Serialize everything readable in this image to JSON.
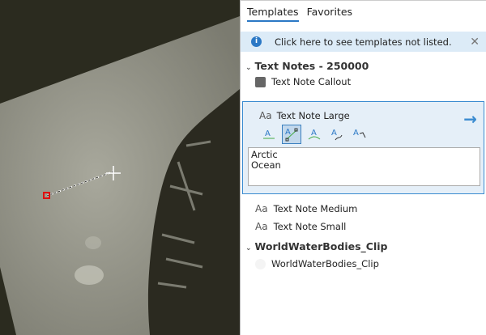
{
  "tabs": [
    {
      "label": "Templates",
      "active": true
    },
    {
      "label": "Favorites",
      "active": false
    }
  ],
  "info": {
    "text": "Click here to see templates not listed.",
    "icon": "info-icon"
  },
  "groups": [
    {
      "label": "Text Notes - 250000",
      "items": [
        {
          "label": "Text Note Callout",
          "icon": "callout-icon"
        }
      ]
    },
    {
      "label": "WorldWaterBodies_Clip",
      "items": [
        {
          "label": "WorldWaterBodies_Clip",
          "icon": "polygon-symbol-icon"
        }
      ]
    }
  ],
  "selected": {
    "label": "Text Note Large",
    "text": "Arctic\nOcean",
    "tools": [
      "horizontal-text-tool",
      "straight-text-tool",
      "curved-text-tool",
      "freehand-text-tool",
      "leader-text-tool"
    ],
    "active_tool": 1
  },
  "other_items": [
    {
      "label": "Text Note Medium"
    },
    {
      "label": "Text Note Small"
    }
  ],
  "icon_glyph": "Aa",
  "colors": {
    "accent": "#2b78c5",
    "selection_bg": "#e5eff8",
    "info_bg": "#dcebf7",
    "sketch_vertex": "#e01010"
  }
}
